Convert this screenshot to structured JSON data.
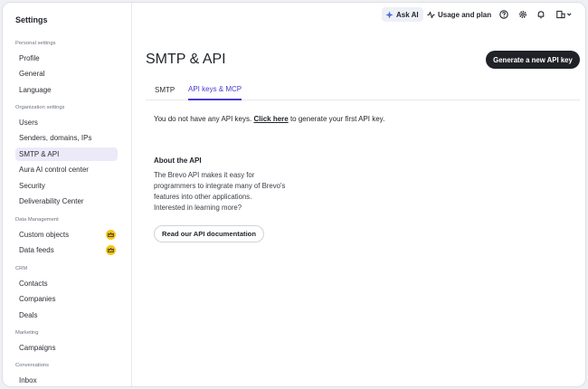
{
  "sidebar": {
    "title": "Settings",
    "sections": [
      {
        "label": "Personal settings",
        "items": [
          {
            "label": "Profile"
          },
          {
            "label": "General"
          },
          {
            "label": "Language"
          }
        ]
      },
      {
        "label": "Organization settings",
        "items": [
          {
            "label": "Users"
          },
          {
            "label": "Senders, domains, IPs"
          },
          {
            "label": "SMTP & API"
          },
          {
            "label": "Aura AI control center"
          },
          {
            "label": "Security"
          },
          {
            "label": "Deliverability Center"
          }
        ]
      },
      {
        "label": "Data Management",
        "items": [
          {
            "label": "Custom objects"
          },
          {
            "label": "Data feeds"
          }
        ]
      },
      {
        "label": "CRM",
        "items": [
          {
            "label": "Contacts"
          },
          {
            "label": "Companies"
          },
          {
            "label": "Deals"
          }
        ]
      },
      {
        "label": "Marketing",
        "items": [
          {
            "label": "Campaigns"
          }
        ]
      },
      {
        "label": "Conversations",
        "items": [
          {
            "label": "Inbox"
          }
        ]
      }
    ],
    "active_item": "SMTP & API"
  },
  "topbar": {
    "ask_ai": "Ask AI",
    "usage": "Usage and plan"
  },
  "colors": {
    "accent": "#4a3bd1",
    "premium_badge": "#f5c518",
    "primary_button": "#1f2328"
  },
  "main": {
    "title": "SMTP & API",
    "generate_button": "Generate a new API key",
    "tabs": [
      {
        "label": "SMTP"
      },
      {
        "label": "API keys & MCP"
      }
    ],
    "active_tab": "API keys & MCP",
    "empty_prefix": "You do not have any API keys.",
    "empty_link": "Click here",
    "empty_suffix": "to generate your first API key.",
    "about_title": "About the API",
    "about_lines": [
      "The Brevo API makes it easy for",
      "programmers to integrate many of Brevo's",
      "features into other applications.",
      "Interested in learning more?"
    ],
    "doc_button": "Read our API documentation"
  }
}
